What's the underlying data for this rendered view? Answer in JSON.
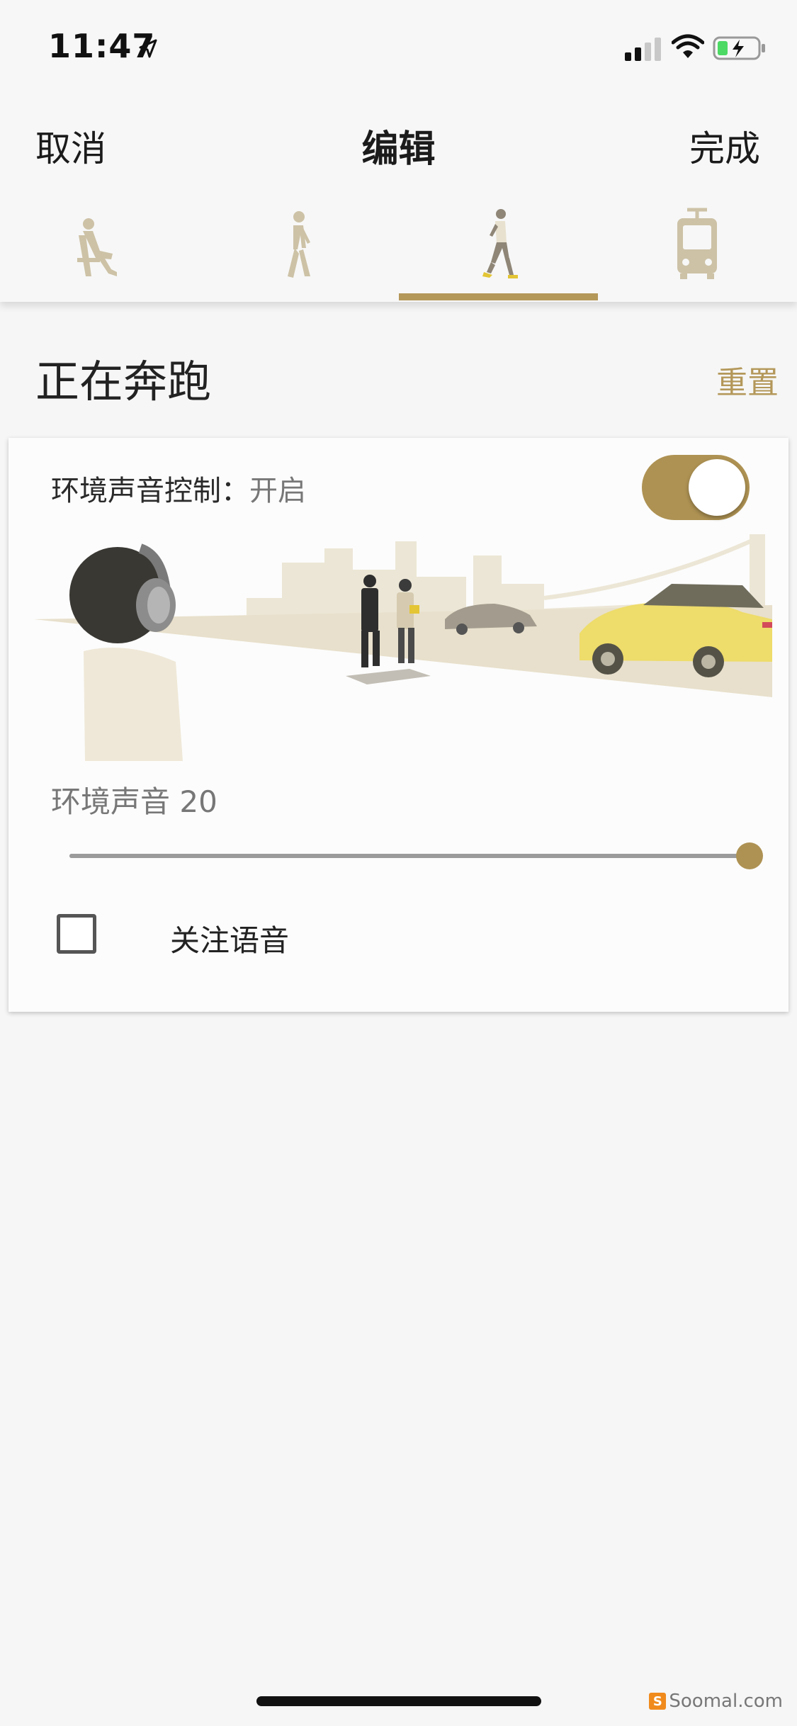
{
  "status_bar": {
    "time": "11:47",
    "icons": [
      "location-arrow-icon",
      "signal-icon",
      "wifi-icon",
      "battery-charging-icon"
    ]
  },
  "nav": {
    "cancel_label": "取消",
    "title": "编辑",
    "done_label": "完成"
  },
  "tabs": [
    {
      "icon": "sitting-icon",
      "active": false
    },
    {
      "icon": "walking-icon",
      "active": false
    },
    {
      "icon": "running-icon",
      "active": true
    },
    {
      "icon": "tram-icon",
      "active": false
    }
  ],
  "section": {
    "title": "正在奔跑",
    "reset_label": "重置"
  },
  "card": {
    "ambient_control_label": "环境声音控制：",
    "ambient_control_state": "开启",
    "toggle_on": true,
    "ambient_level_label": "环境声音 20",
    "ambient_level_value": 20,
    "ambient_level_max": 20,
    "focus_voice_label": "关注语音",
    "focus_voice_checked": false
  },
  "colors": {
    "accent": "#b4985a",
    "background": "#f6f6f6",
    "card": "#fcfcfc"
  },
  "watermark": {
    "icon_glyph": "S",
    "text": "Soomal.com"
  }
}
